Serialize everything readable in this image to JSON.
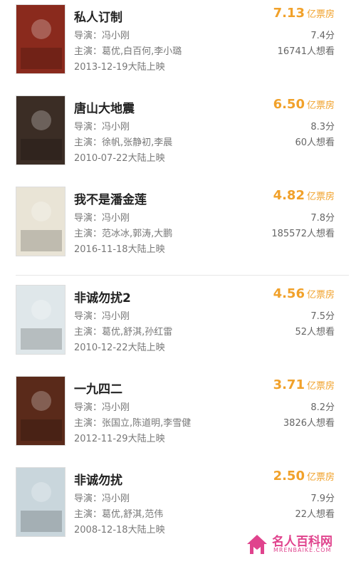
{
  "labels": {
    "director_prefix": "导演：",
    "cast_prefix": "主演：",
    "release_suffix": "大陆上映",
    "box_unit": "亿票房"
  },
  "movies": [
    {
      "title": "私人订制",
      "box_office": "7.13",
      "director": "冯小刚",
      "cast": "葛优,白百何,李小璐",
      "release_date": "2013-12-19",
      "score": "7.4分",
      "want": "16741人想看",
      "poster_color": "#8a2a1d"
    },
    {
      "title": "唐山大地震",
      "box_office": "6.50",
      "director": "冯小刚",
      "cast": "徐帆,张静初,李晨",
      "release_date": "2010-07-22",
      "score": "8.3分",
      "want": "60人想看",
      "poster_color": "#3b2d25"
    },
    {
      "title": "我不是潘金莲",
      "box_office": "4.82",
      "director": "冯小刚",
      "cast": "范冰冰,郭涛,大鹏",
      "release_date": "2016-11-18",
      "score": "7.8分",
      "want": "185572人想看",
      "poster_color": "#e9e4d6"
    },
    {
      "title": "非诚勿扰2",
      "box_office": "4.56",
      "director": "冯小刚",
      "cast": "葛优,舒淇,孙红雷",
      "release_date": "2010-12-22",
      "score": "7.5分",
      "want": "52人想看",
      "poster_color": "#dfe7ea"
    },
    {
      "title": "一九四二",
      "box_office": "3.71",
      "director": "冯小刚",
      "cast": "张国立,陈道明,李雪健",
      "release_date": "2012-11-29",
      "score": "8.2分",
      "want": "3826人想看",
      "poster_color": "#5a2a1a"
    },
    {
      "title": "非诚勿扰",
      "box_office": "2.50",
      "director": "冯小刚",
      "cast": "葛优,舒淇,范伟",
      "release_date": "2008-12-18",
      "score": "7.9分",
      "want": "22人想看",
      "poster_color": "#c9d6dc"
    }
  ],
  "watermark": {
    "cn": "名人百科网",
    "en": "MRENBAIKE.COM"
  }
}
